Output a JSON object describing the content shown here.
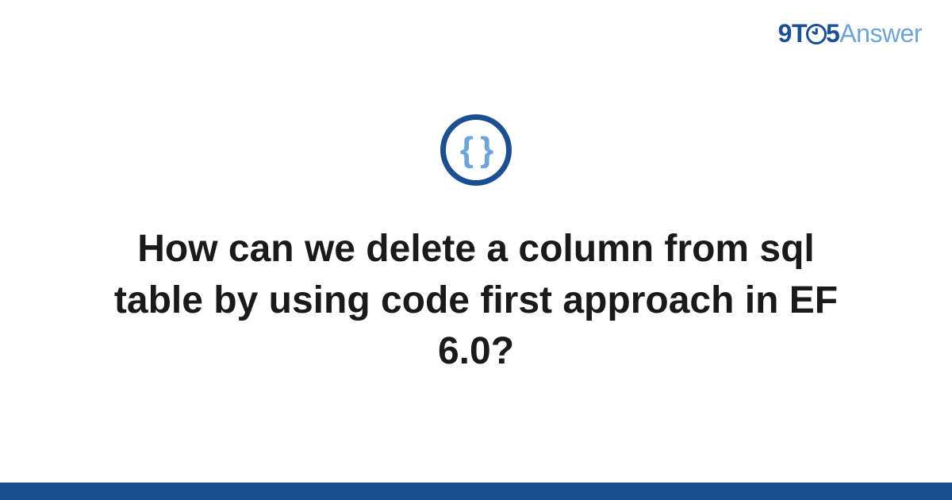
{
  "logo": {
    "part1": "9T",
    "part2": "5",
    "part3": "Answer"
  },
  "icon": {
    "glyph": "{ }"
  },
  "title": "How can we delete a column from sql table by using code first approach in EF 6.0?"
}
